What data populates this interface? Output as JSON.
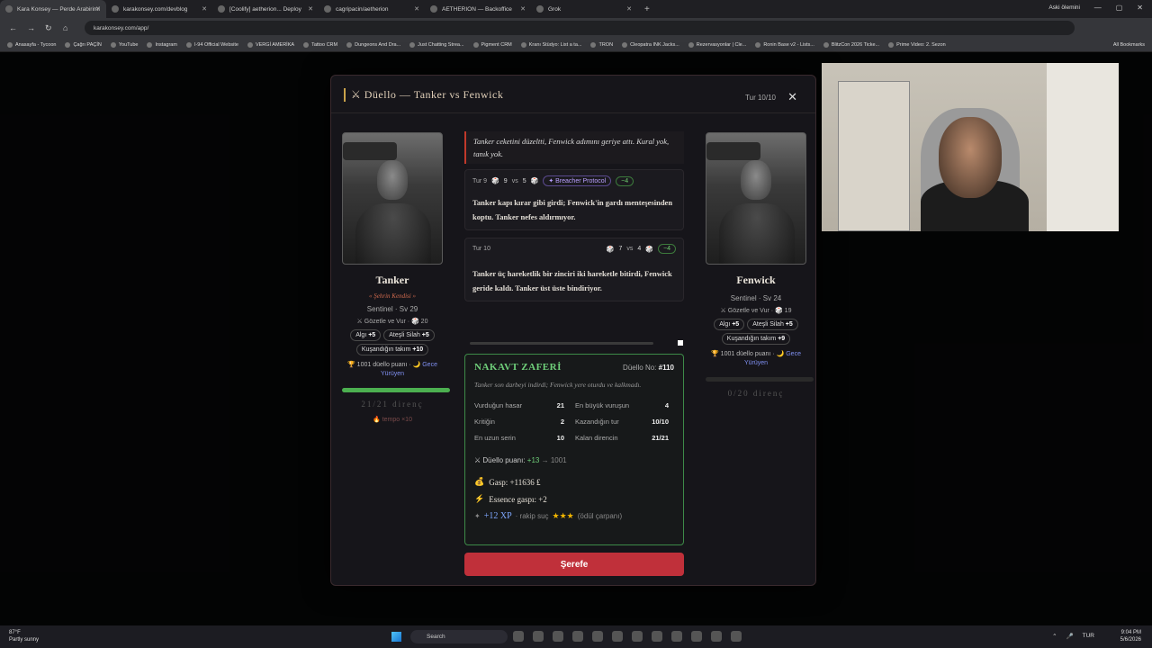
{
  "browser": {
    "tabs": [
      {
        "label": "Kara Konsey — Perde Arabirimi"
      },
      {
        "label": "karakonsey.com/devblog"
      },
      {
        "label": "[Coolify] aetherion... Deploy"
      },
      {
        "label": "cagripacin/aetherion"
      },
      {
        "label": "AETHERION — Backoffice"
      },
      {
        "label": "Grok"
      }
    ],
    "url": "karakonsey.com/app/",
    "profile": "Aski ölemini",
    "bookmarks": [
      "Anasayfa - Tycoon",
      "Çağrı PAÇİN",
      "YouTube",
      "Instagram",
      "I-94 Official Website",
      "VERGİ AMERİKA",
      "Tattoo CRM",
      "Dungeons And Dra...",
      "Just Chatting Strea...",
      "Pigment CRM",
      "Kranı Stüdyo: List a ta...",
      "TRON",
      "Cleopatra INK Jacks...",
      "Rezervasyonlar | Cle...",
      "Ronin Base v2 - Lists...",
      "BlitzCon 2026 Ticke...",
      "Prime Video: 2. Sezon"
    ],
    "all_bookmarks": "All Bookmarks"
  },
  "modal": {
    "title": "⚔ Düello — Tanker vs Fenwick",
    "round_indicator": "Tur 10/10",
    "close": "✕"
  },
  "left_fighter": {
    "name": "Tanker",
    "title": "« Şehrin Kendisi »",
    "class_level": "Sentinel · Sv 29",
    "skill": "⚔ Gözetle ve Vur · 🎲 20",
    "chips": [
      {
        "label": "Algı",
        "value": "+5"
      },
      {
        "label": "Ateşli Silah",
        "value": "+5"
      },
      {
        "label": "Kuşandığın takım",
        "value": "+10"
      }
    ],
    "points": "🏆 1001 düello puanı · 🌙",
    "night": "Gece Yürüyen",
    "resist": "21/21 direnç",
    "hp_fraction": 1.0,
    "tempo": "🔥 tempo ×10"
  },
  "right_fighter": {
    "name": "Fenwick",
    "class_level": "Sentinel · Sv 24",
    "skill": "⚔ Gözetle ve Vur · 🎲 19",
    "chips": [
      {
        "label": "Algı",
        "value": "+5"
      },
      {
        "label": "Ateşli Silah",
        "value": "+5"
      },
      {
        "label": "Kuşandığın takım",
        "value": "+9"
      }
    ],
    "points": "🏆 1001 düello puanı · 🌙",
    "night": "Gece Yürüyen",
    "resist": "0/20 direnç",
    "hp_fraction": 0.0
  },
  "log": {
    "intro": "Tanker ceketini düzeltti, Fenwick adımını geriye attı. Kural yok, tanık yok.",
    "rounds": [
      {
        "label": "Tur 9",
        "a": "9",
        "vs": "vs",
        "b": "5",
        "skill": "✦ Breacher Protocol",
        "dmg": "−4",
        "text": "Tanker kapı kırar gibi girdi; Fenwick'in gardı menteşesinden koptu. Tanker nefes aldırmıyor."
      },
      {
        "label": "Tur 10",
        "a": "7",
        "vs": "vs",
        "b": "4",
        "dmg": "−4",
        "text": "Tanker üç hareketlik bir zinciri iki hareketle bitirdi, Fenwick geride kaldı. Tanker üst üste bindiriyor."
      }
    ]
  },
  "result": {
    "title": "NAKAVT ZAFERİ",
    "duel_no_label": "Düello No:",
    "duel_no": "#110",
    "description": "Tanker son darbeyi indirdi; Fenwick yere oturdu ve kalkmadı.",
    "stats": [
      {
        "label": "Vurduğun hasar",
        "value": "21",
        "label2": "En büyük vuruşun",
        "value2": "4"
      },
      {
        "label": "Kritiğin",
        "value": "2",
        "label2": "Kazandığın tur",
        "value2": "10/10"
      },
      {
        "label": "En uzun serin",
        "value": "10",
        "label2": "Kalan direncin",
        "value2": "21/21"
      }
    ],
    "points_label": "⚔ Düello puanı:",
    "points_delta": "+13",
    "points_total": "→ 1001",
    "gasp": "Gasp: +11636 ₤",
    "essence": "Essence gaspı: +2",
    "xp": "+12 XP",
    "xp_note": "· rakip suç",
    "stars": "★★★",
    "xp_suffix": "(ödül çarpanı)"
  },
  "honor_button": "Şerefe",
  "taskbar": {
    "weather_temp": "87°F",
    "weather_desc": "Partly sunny",
    "search": "Search",
    "lang": "TUR",
    "time": "9:04 PM",
    "date": "5/6/2026"
  }
}
